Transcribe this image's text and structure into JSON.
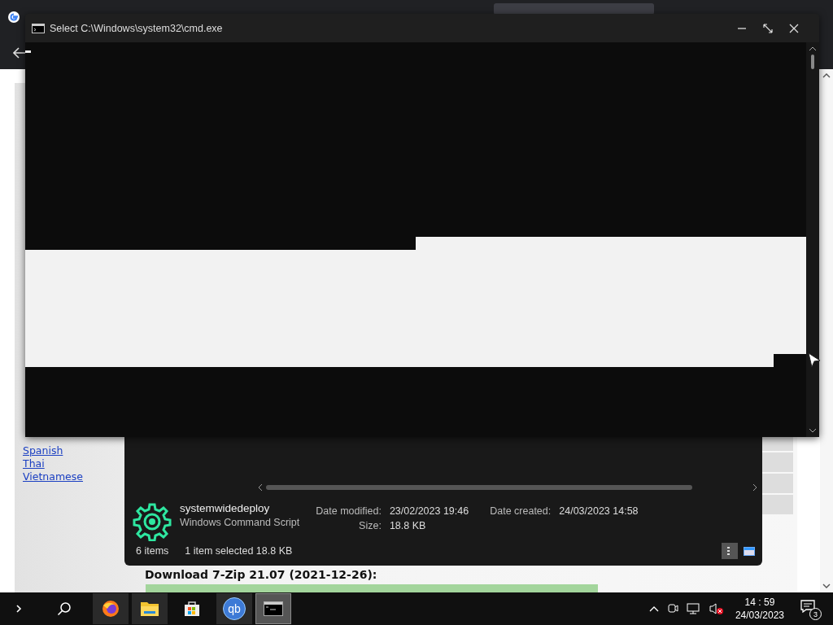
{
  "browser": {
    "links": [
      "Spanish",
      "Thai",
      "Vietnamese"
    ],
    "download_heading": "Download 7-Zip 21.07 (2021-12-26):"
  },
  "cmd_window": {
    "title": "Select C:\\Windows\\system32\\cmd.exe"
  },
  "explorer": {
    "file_name": "systemwidedeploy",
    "file_type": "Windows Command Script",
    "details": [
      {
        "label": "Date modified:",
        "value": "23/02/2023 19:46"
      },
      {
        "label": "Size:",
        "value": "18.8 KB"
      },
      {
        "label": "Date created:",
        "value": "24/03/2023 14:58"
      }
    ],
    "item_count": "6 items",
    "selection": "1 item selected  18.8 KB",
    "views": [
      {
        "kind": "details",
        "selected": true
      },
      {
        "kind": "preview",
        "selected": false
      }
    ]
  },
  "taskbar": {
    "apps": [
      {
        "kind": "firefox",
        "selected": false
      },
      {
        "kind": "folder",
        "selected": false
      },
      {
        "kind": "store",
        "selected": false
      },
      {
        "kind": "qb",
        "label": "qb",
        "selected": false
      },
      {
        "kind": "terminal",
        "selected": true
      }
    ],
    "time": "14 : 59",
    "date": "24/03/2023",
    "notifications": "3"
  }
}
